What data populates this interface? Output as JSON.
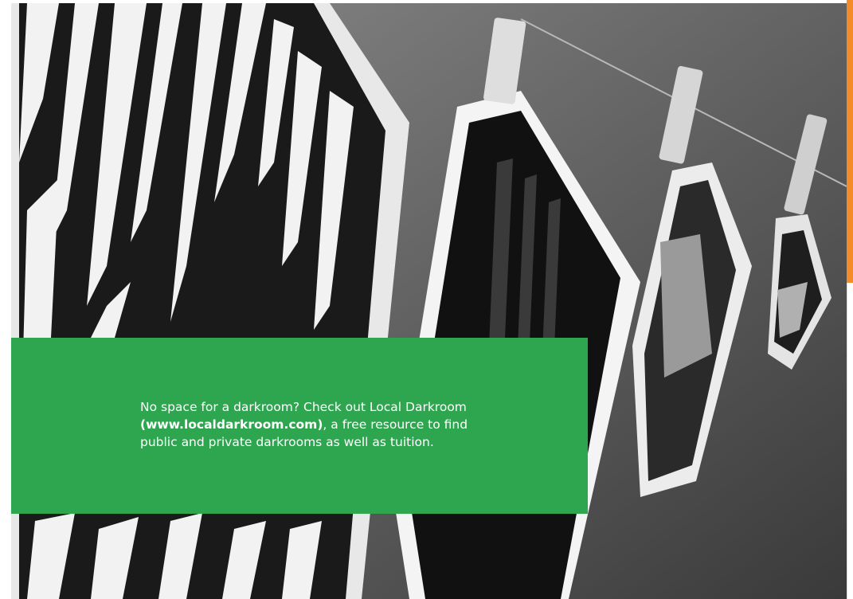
{
  "callout": {
    "text_before": "No space for a darkroom? Check out Local Darkroom ",
    "url": "(www.localdarkroom.com)",
    "text_after": ", a free resource to find public and private darkrooms as well as tuition."
  },
  "colors": {
    "callout_background": "#2ea64f",
    "accent_bar": "#f28c28",
    "text": "#ffffff"
  }
}
